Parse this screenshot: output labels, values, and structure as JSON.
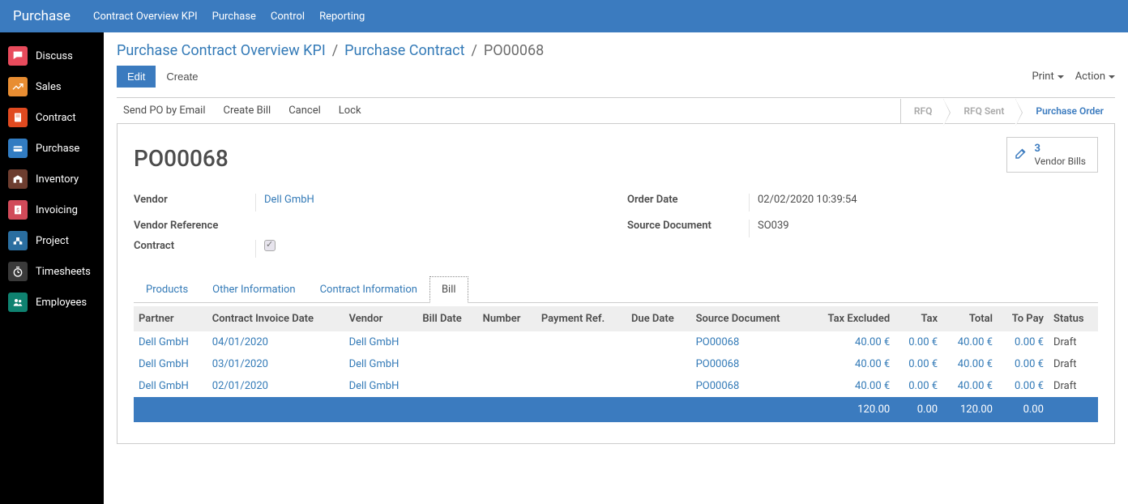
{
  "topbar": {
    "title": "Purchase",
    "menu": [
      "Contract Overview KPI",
      "Purchase",
      "Control",
      "Reporting"
    ]
  },
  "sidebar": {
    "items": [
      {
        "label": "Discuss",
        "color": "#e84b5c",
        "icon": "discuss"
      },
      {
        "label": "Sales",
        "color": "#e88d32",
        "icon": "sales"
      },
      {
        "label": "Contract",
        "color": "#e04a20",
        "icon": "contract"
      },
      {
        "label": "Purchase",
        "color": "#317cc2",
        "icon": "purchase"
      },
      {
        "label": "Inventory",
        "color": "#6d3d2f",
        "icon": "inventory"
      },
      {
        "label": "Invoicing",
        "color": "#d14a59",
        "icon": "invoicing"
      },
      {
        "label": "Project",
        "color": "#2a6ea0",
        "icon": "project"
      },
      {
        "label": "Timesheets",
        "color": "#3a3a3a",
        "icon": "timesheets"
      },
      {
        "label": "Employees",
        "color": "#0f8270",
        "icon": "employees"
      }
    ]
  },
  "breadcrumb": {
    "items": [
      "Purchase Contract Overview KPI",
      "Purchase Contract",
      "PO00068"
    ]
  },
  "buttons": {
    "edit": "Edit",
    "create": "Create",
    "print": "Print",
    "action": "Action"
  },
  "actions": {
    "send_po": "Send PO by Email",
    "create_bill": "Create Bill",
    "cancel": "Cancel",
    "lock": "Lock"
  },
  "status": {
    "rfq": "RFQ",
    "rfq_sent": "RFQ Sent",
    "po": "Purchase Order"
  },
  "stat": {
    "count": "3",
    "label": "Vendor Bills"
  },
  "record": {
    "title": "PO00068",
    "vendor_label": "Vendor",
    "vendor": "Dell GmbH",
    "vendor_ref_label": "Vendor Reference",
    "vendor_ref": "",
    "contract_label": "Contract",
    "order_date_label": "Order Date",
    "order_date": "02/02/2020 10:39:54",
    "source_doc_label": "Source Document",
    "source_doc": "SO039"
  },
  "tabs": [
    "Products",
    "Other Information",
    "Contract Information",
    "Bill"
  ],
  "bill_table": {
    "headers": {
      "partner": "Partner",
      "invoice_date": "Contract Invoice Date",
      "vendor": "Vendor",
      "bill_date": "Bill Date",
      "number": "Number",
      "payment_ref": "Payment Ref.",
      "due_date": "Due Date",
      "source": "Source Document",
      "tax_excl": "Tax Excluded",
      "tax": "Tax",
      "total": "Total",
      "to_pay": "To Pay",
      "status": "Status"
    },
    "rows": [
      {
        "partner": "Dell GmbH",
        "invoice_date": "04/01/2020",
        "vendor": "Dell GmbH",
        "bill_date": "",
        "number": "",
        "payment_ref": "",
        "due_date": "",
        "source": "PO00068",
        "tax_excl": "40.00 €",
        "tax": "0.00 €",
        "total": "40.00 €",
        "to_pay": "0.00 €",
        "status": "Draft"
      },
      {
        "partner": "Dell GmbH",
        "invoice_date": "03/01/2020",
        "vendor": "Dell GmbH",
        "bill_date": "",
        "number": "",
        "payment_ref": "",
        "due_date": "",
        "source": "PO00068",
        "tax_excl": "40.00 €",
        "tax": "0.00 €",
        "total": "40.00 €",
        "to_pay": "0.00 €",
        "status": "Draft"
      },
      {
        "partner": "Dell GmbH",
        "invoice_date": "02/01/2020",
        "vendor": "Dell GmbH",
        "bill_date": "",
        "number": "",
        "payment_ref": "",
        "due_date": "",
        "source": "PO00068",
        "tax_excl": "40.00 €",
        "tax": "0.00 €",
        "total": "40.00 €",
        "to_pay": "0.00 €",
        "status": "Draft"
      }
    ],
    "totals": {
      "tax_excl": "120.00",
      "tax": "0.00",
      "total": "120.00",
      "to_pay": "0.00"
    }
  }
}
